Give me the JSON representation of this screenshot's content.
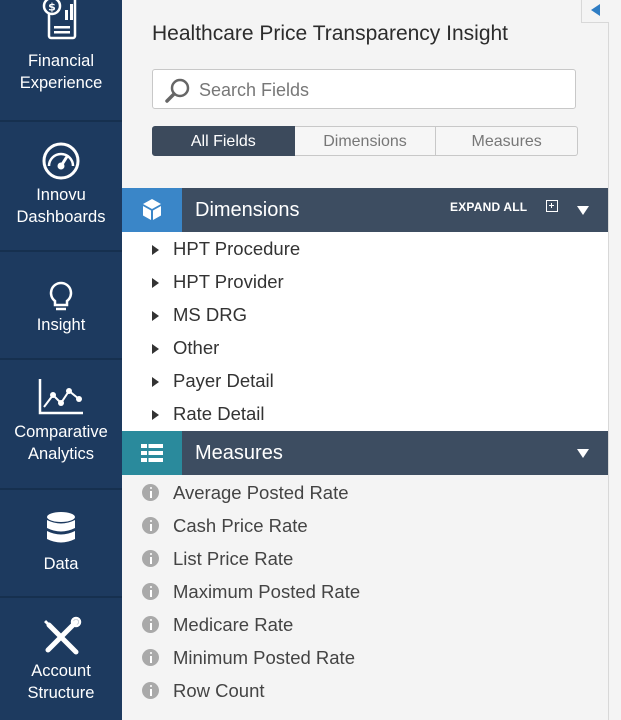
{
  "nav": {
    "items": [
      {
        "label_lines": [
          "Financial",
          "Experience"
        ],
        "icon": "financial-report-icon"
      },
      {
        "label_lines": [
          "Innovu",
          "Dashboards"
        ],
        "icon": "gauge-icon"
      },
      {
        "label_lines": [
          "Insight"
        ],
        "icon": "lightbulb-icon"
      },
      {
        "label_lines": [
          "Comparative",
          "Analytics"
        ],
        "icon": "line-chart-icon"
      },
      {
        "label_lines": [
          "Data"
        ],
        "icon": "database-icon"
      },
      {
        "label_lines": [
          "Account",
          "Structure"
        ],
        "icon": "tools-icon"
      }
    ]
  },
  "panel": {
    "title": "Healthcare Price Transparency Insight",
    "search_placeholder": "Search Fields",
    "tabs": [
      {
        "label": "All Fields",
        "active": true
      },
      {
        "label": "Dimensions",
        "active": false
      },
      {
        "label": "Measures",
        "active": false
      }
    ]
  },
  "dimensions": {
    "title": "Dimensions",
    "expand_all": "EXPAND ALL",
    "items": [
      "HPT Procedure",
      "HPT Provider",
      "MS DRG",
      "Other",
      "Payer Detail",
      "Rate Detail"
    ]
  },
  "measures": {
    "title": "Measures",
    "items": [
      "Average Posted Rate",
      "Cash Price Rate",
      "List Price Rate",
      "Maximum Posted Rate",
      "Medicare Rate",
      "Minimum Posted Rate",
      "Row Count"
    ]
  },
  "colors": {
    "nav_bg": "#1d3a5f",
    "header_bg": "#3d4d61",
    "dimensions_accent": "#3a86c8",
    "measures_accent": "#2a8a9c"
  }
}
